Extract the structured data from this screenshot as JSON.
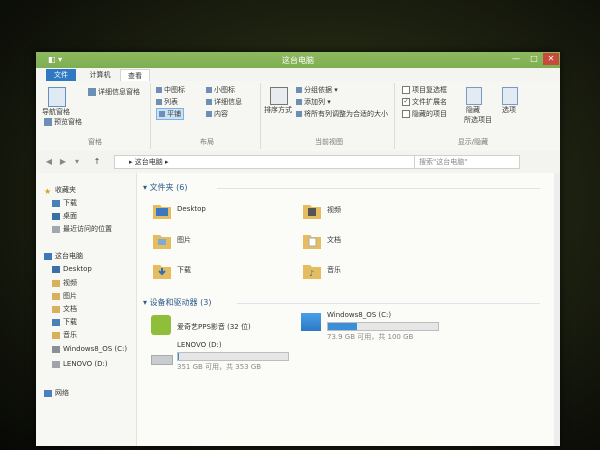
{
  "window": {
    "title": "这台电脑",
    "quick_access": "◧ ▾",
    "controls": [
      "—",
      "□",
      "✕"
    ]
  },
  "ribbon_tabs": [
    "文件",
    "计算机",
    "查看"
  ],
  "ribbon": {
    "panes": {
      "nav_pane": "导航窗格",
      "preview_pane": "预览窗格",
      "details_pane": "详细信息窗格",
      "group_label": "窗格"
    },
    "layout": {
      "items": [
        "中图标",
        "小图标",
        "列表",
        "详细信息",
        "平铺",
        "内容"
      ],
      "selected": "平铺",
      "group_label": "布局"
    },
    "current_view": {
      "sort": "排序方式",
      "group_by": "分组依据",
      "add_column": "添加列",
      "fit_columns": "将所有列调整为合适的大小",
      "group_label": "当前视图"
    },
    "show_hide": {
      "item_checkbox": "项目复选框",
      "extensions": "文件扩展名",
      "hidden_items": "隐藏的项目",
      "hide_selected": "隐藏",
      "hide_selected2": "所选项目",
      "options": "选项",
      "group_label": "显示/隐藏"
    }
  },
  "address": {
    "path": "▸ 这台电脑 ▸",
    "search_placeholder": "搜索\"这台电脑\""
  },
  "nav": {
    "favorites": "收藏夹",
    "downloads": "下载",
    "desktop": "桌面",
    "recent": "最近访问的位置",
    "this_pc": "这台电脑",
    "pc_items": [
      "Desktop",
      "视频",
      "图片",
      "文档",
      "下载",
      "音乐",
      "Windows8_OS (C:)",
      "LENOVO (D:)"
    ],
    "network": "网络"
  },
  "content": {
    "folders_header": "文件夹 (6)",
    "folders": [
      "Desktop",
      "视频",
      "图片",
      "文档",
      "下载",
      "音乐"
    ],
    "drives_header": "设备和驱动器 (3)",
    "drives": [
      {
        "name": "爱奇艺PPS影音 (32 位)"
      },
      {
        "name": "Windows8_OS (C:)",
        "free": "73.9 GB 可用，共 100 GB",
        "used_fraction": 0.26
      },
      {
        "name": "LENOVO (D:)",
        "free": "351 GB 可用，共 353 GB",
        "used_fraction": 0.006
      }
    ]
  }
}
